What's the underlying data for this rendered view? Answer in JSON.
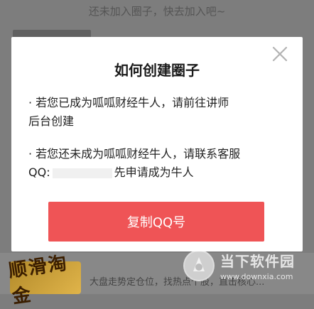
{
  "backdrop": {
    "top_message": "还未加入圈子，快去加入吧~",
    "thumb_text": "顺滑淘金",
    "bottom_text": "大盘走势定仓位，找热点个股，直击核心..."
  },
  "modal": {
    "title": "如何创建圈子",
    "bullet1": {
      "line1": "· 若您已成为呱呱财经牛人，请前往讲师",
      "line2": "后台创建"
    },
    "bullet2": {
      "line1": "· 若您还未成为呱呱财经牛人，请联系客服",
      "qq_label": "QQ:",
      "qq_suffix": "先申请成为牛人"
    },
    "copy_button": "复制QQ号",
    "accent_color": "#ef5456"
  },
  "watermark": {
    "title": "当下软件园",
    "url": "www.downxia.com"
  }
}
